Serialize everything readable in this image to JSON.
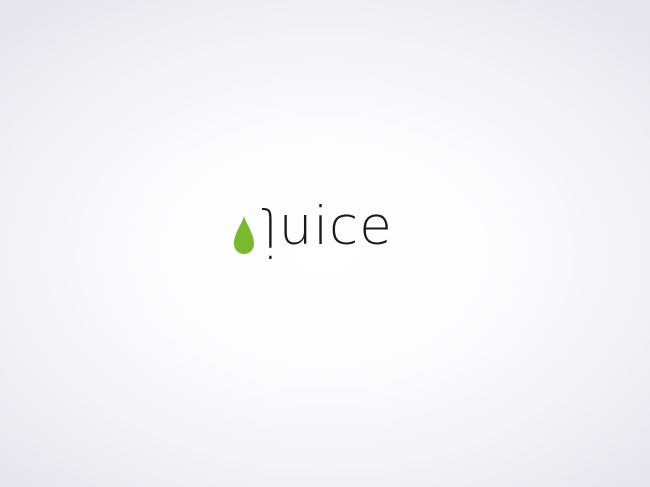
{
  "logo": {
    "first_letter": "j",
    "rest": "uice",
    "drop_icon": "drop-icon",
    "drop_color": "#7ab82e",
    "text_color": "#1a1a1a"
  }
}
